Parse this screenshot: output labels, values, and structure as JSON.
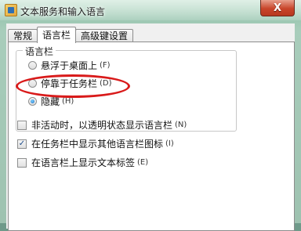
{
  "window": {
    "title": "文本服务和输入语言",
    "close_glyph": "X"
  },
  "tabs": [
    {
      "label": "常规"
    },
    {
      "label": "语言栏",
      "active": true
    },
    {
      "label": "高级键设置"
    }
  ],
  "language_bar": {
    "group_label": "语言栏",
    "options": [
      {
        "label": "悬浮于桌面上",
        "hint": "(F)",
        "checked": false
      },
      {
        "label": "停靠于任务栏",
        "hint": "(D)",
        "checked": false
      },
      {
        "label": "隐藏",
        "hint": "(H)",
        "checked": true
      }
    ]
  },
  "checkboxes": [
    {
      "label": "非活动时，以透明状态显示语言栏",
      "hint": "(N)",
      "checked": false
    },
    {
      "label": "在任务栏中显示其他语言栏图标",
      "hint": "(I)",
      "checked": true
    },
    {
      "label": "在语言栏上显示文本标签",
      "hint": "(E)",
      "checked": false
    }
  ],
  "annotation_color": "#d91a1a"
}
